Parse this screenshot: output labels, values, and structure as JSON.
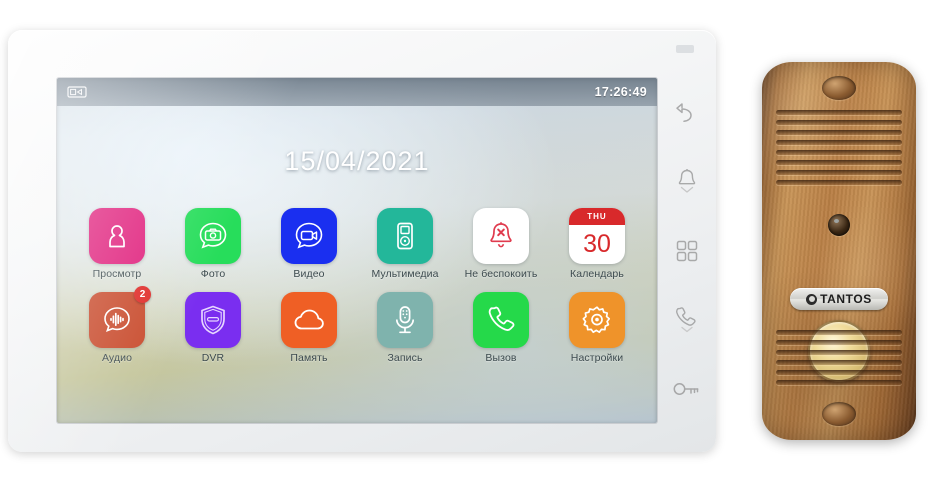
{
  "device": {
    "indoor_monitor_name": "indoor-video-intercom-monitor",
    "outdoor_panel_brand": "TANTOS"
  },
  "screen": {
    "status_bar": {
      "left_icon": "monitor-screen-icon",
      "clock": "17:26:49"
    },
    "date_display": "15/04/2021",
    "menu_rows": [
      [
        {
          "label": "Просмотр",
          "icon": "person-door-icon",
          "color": "#e01f7c",
          "badge": ""
        },
        {
          "label": "Фото",
          "icon": "photo-camera-icon",
          "color": "#27dd5b",
          "badge": ""
        },
        {
          "label": "Видео",
          "icon": "video-camera-icon",
          "color": "#1a2ff0",
          "badge": ""
        },
        {
          "label": "Мультимедиа",
          "icon": "media-player-icon",
          "color": "#23b79a",
          "badge": ""
        },
        {
          "label": "Не беспокоить",
          "icon": "bell-muted-icon",
          "color": "#ffffff",
          "badge": ""
        },
        {
          "label": "Календарь",
          "icon": "calendar-icon",
          "color": "#ffffff",
          "badge": "",
          "calendar_weekday": "THU",
          "calendar_day": "30",
          "calendar_header_color": "#d8292b"
        }
      ],
      [
        {
          "label": "Аудио",
          "icon": "audio-wave-icon",
          "color": "#c94c2e",
          "badge": "2"
        },
        {
          "label": "DVR",
          "icon": "shield-icon",
          "color": "#7a2ef0",
          "badge": ""
        },
        {
          "label": "Память",
          "icon": "cloud-icon",
          "color": "#ef5f25",
          "badge": ""
        },
        {
          "label": "Запись",
          "icon": "microphone-icon",
          "color": "#7fb3ad",
          "badge": ""
        },
        {
          "label": "Вызов",
          "icon": "phone-icon",
          "color": "#25d94a",
          "badge": ""
        },
        {
          "label": "Настройки",
          "icon": "gear-icon",
          "color": "#ef932a",
          "badge": ""
        }
      ]
    ]
  },
  "hardware_buttons": [
    {
      "name": "back-button",
      "icon": "back-arrow-icon"
    },
    {
      "name": "monitor-button",
      "icon": "bell-chevron-icon"
    },
    {
      "name": "menu-button",
      "icon": "grid-squares-icon"
    },
    {
      "name": "talk-button",
      "icon": "phone-chevron-icon"
    },
    {
      "name": "unlock-button",
      "icon": "key-icon"
    }
  ],
  "outdoor_panel": {
    "logo_text": "TANTOS",
    "call_button": "call-button",
    "camera": "camera-lens",
    "screws": [
      "screw-top",
      "screw-bottom"
    ]
  }
}
